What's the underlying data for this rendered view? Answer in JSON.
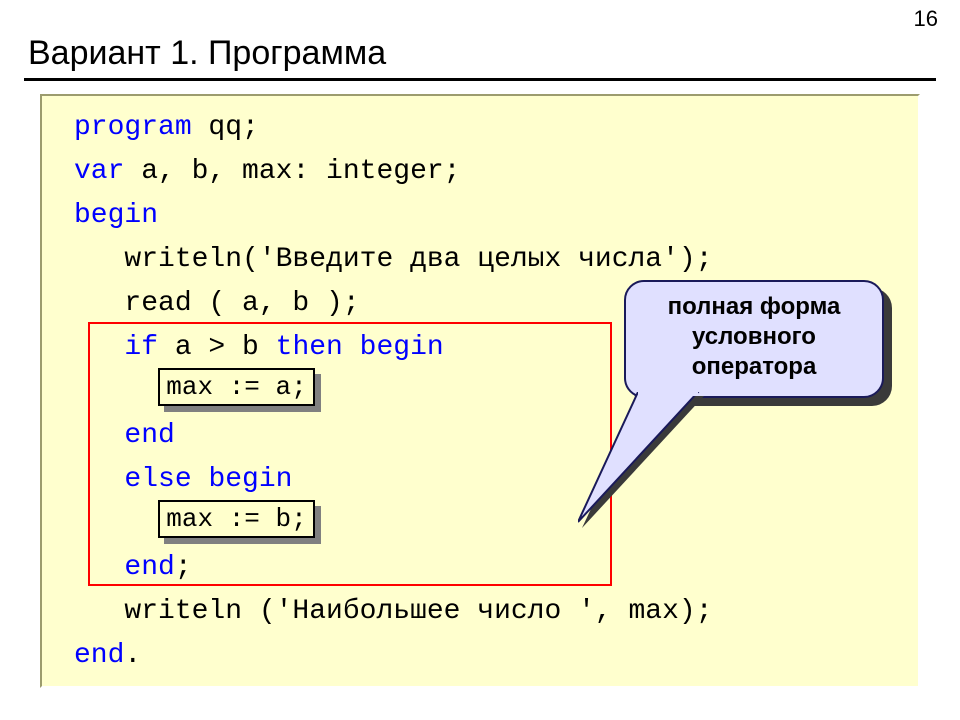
{
  "page_number": "16",
  "title": "Вариант 1. Программа",
  "code": {
    "l1_a": "program",
    "l1_b": " qq;",
    "l2_a": "var",
    "l2_b": " a, b, max: integer;",
    "l3_a": "begin",
    "l4": "   writeln('Введите два целых числа');",
    "l5": "   read ( a, b );",
    "l6_a": "   if",
    "l6_b": " a > b ",
    "l6_c": "then begin",
    "l7": "",
    "l8": "   end",
    "l9_a": "   else",
    "l9_b": " ",
    "l9_c": "begin",
    "l10": "",
    "l11_a": "   end",
    "l11_b": ";",
    "l12": "   writeln ('Наибольшее число ', max);",
    "l13_a": "end",
    "l13_b": "."
  },
  "snippet_a": "max := a;",
  "snippet_b": "max := b;",
  "callout": "полная форма условного оператора"
}
